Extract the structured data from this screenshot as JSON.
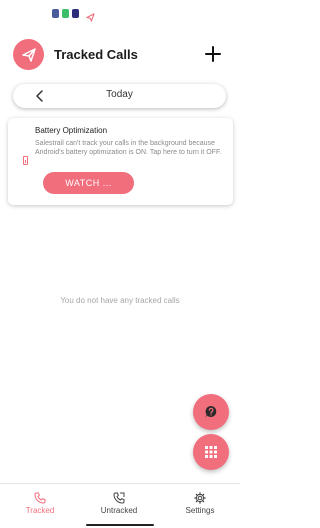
{
  "status_bar": {
    "icons": [
      "app-notification-icon",
      "whatsapp-icon",
      "messages-icon",
      "paper-plane-icon"
    ]
  },
  "header": {
    "title": "Tracked Calls",
    "logo_icon": "paper-plane-icon",
    "add_icon": "plus-icon"
  },
  "date_bar": {
    "prev_icon": "chevron-left-icon",
    "label": "Today"
  },
  "banner": {
    "icon": "battery-icon",
    "title": "Battery Optimization",
    "message": "Salestrail can't track your calls in the background because Android's battery optimization is ON. Tap here to turn it OFF.",
    "button_label": "WATCH ..."
  },
  "empty_state": {
    "text": "You do not have any tracked calls"
  },
  "fabs": {
    "help_icon": "help-bubble-icon",
    "dialpad_icon": "dialpad-icon"
  },
  "bottom_nav": {
    "items": [
      {
        "label": "Tracked",
        "icon": "phone-icon",
        "active": true
      },
      {
        "label": "Untracked",
        "icon": "phone-outgoing-icon",
        "active": false
      },
      {
        "label": "Settings",
        "icon": "gear-icon",
        "active": false
      }
    ]
  },
  "colors": {
    "accent": "#f16e7c",
    "text": "#222222",
    "muted": "#a7a7a7"
  }
}
